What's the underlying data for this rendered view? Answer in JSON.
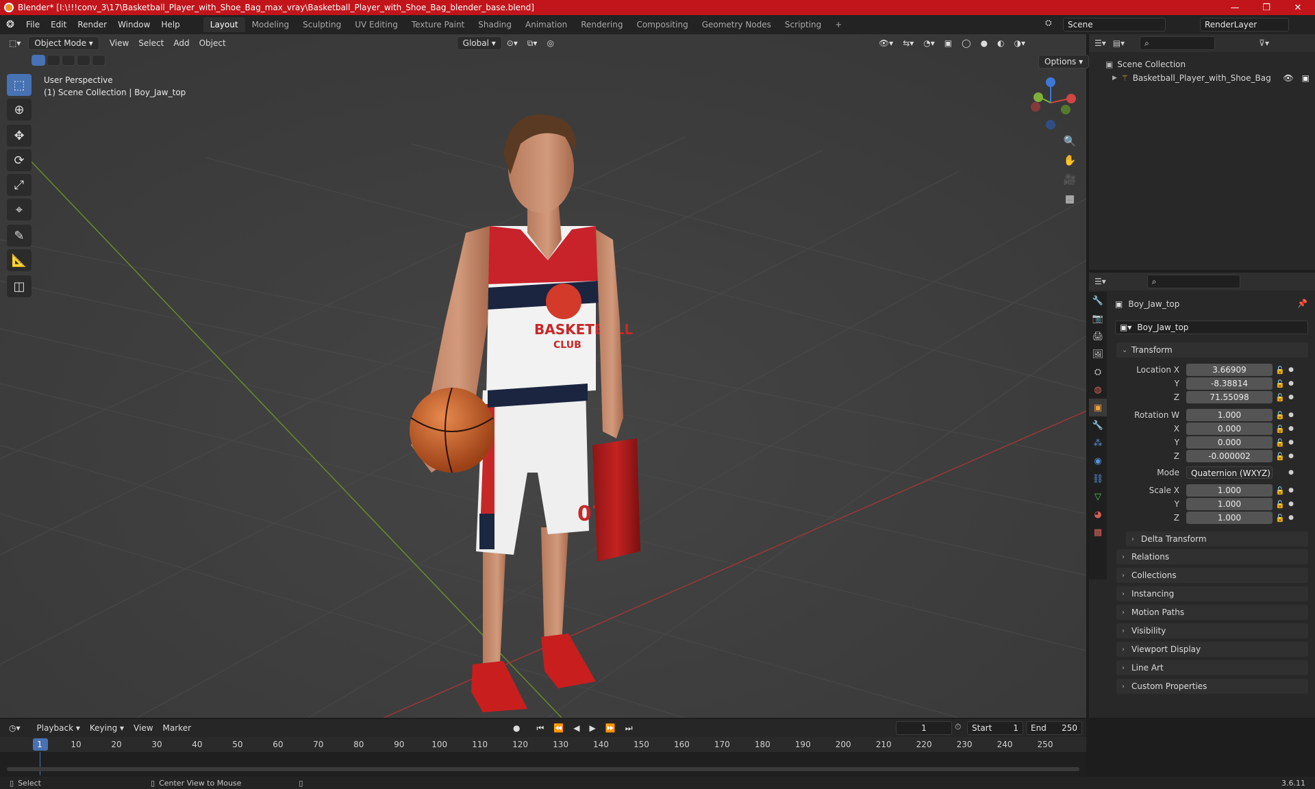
{
  "window": {
    "title": "Blender* [I:\\!!!conv_3\\17\\Basketball_Player_with_Shoe_Bag_max_vray\\Basketball_Player_with_Shoe_Bag_blender_base.blend]",
    "minimize": "—",
    "maximize": "❐",
    "close": "✕"
  },
  "menu": {
    "items": [
      "File",
      "Edit",
      "Render",
      "Window",
      "Help"
    ],
    "workspaces": [
      "Layout",
      "Modeling",
      "Sculpting",
      "UV Editing",
      "Texture Paint",
      "Shading",
      "Animation",
      "Rendering",
      "Compositing",
      "Geometry Nodes",
      "Scripting"
    ],
    "add_workspace": "+",
    "scene_name": "Scene",
    "render_layer": "RenderLayer"
  },
  "viewport": {
    "mode": "Object Mode",
    "menus": [
      "View",
      "Select",
      "Add",
      "Object"
    ],
    "orientation": "Global",
    "options": "Options",
    "perspective": "User Perspective",
    "collection_path": "(1) Scene Collection | Boy_Jaw_top"
  },
  "outliner": {
    "root": "Scene Collection",
    "item": "Basketball_Player_with_Shoe_Bag"
  },
  "properties": {
    "object_name": "Boy_Jaw_top",
    "data_name": "Boy_Jaw_top",
    "transform_label": "Transform",
    "location": {
      "label_x": "Location X",
      "label_y": "Y",
      "label_z": "Z",
      "x": "3.66909",
      "y": "-8.38814",
      "z": "71.55098"
    },
    "rotation": {
      "label_w": "Rotation W",
      "label_x": "X",
      "label_y": "Y",
      "label_z": "Z",
      "w": "1.000",
      "x": "0.000",
      "y": "0.000",
      "z": "-0.000002"
    },
    "mode_label": "Mode",
    "mode_value": "Quaternion (WXYZ)",
    "scale": {
      "label_x": "Scale X",
      "label_y": "Y",
      "label_z": "Z",
      "x": "1.000",
      "y": "1.000",
      "z": "1.000"
    },
    "delta_transform": "Delta Transform",
    "panels": [
      "Relations",
      "Collections",
      "Instancing",
      "Motion Paths",
      "Visibility",
      "Viewport Display",
      "Line Art",
      "Custom Properties"
    ]
  },
  "timeline": {
    "menus": [
      "Playback",
      "Keying",
      "View",
      "Marker"
    ],
    "current_frame": "1",
    "start_label": "Start",
    "start": "1",
    "end_label": "End",
    "end": "250",
    "ticks": [
      "1",
      "10",
      "20",
      "30",
      "40",
      "50",
      "60",
      "70",
      "80",
      "90",
      "100",
      "110",
      "120",
      "130",
      "140",
      "150",
      "160",
      "170",
      "180",
      "190",
      "200",
      "210",
      "220",
      "230",
      "240",
      "250"
    ]
  },
  "status": {
    "select": "Select",
    "center": "Center View to Mouse",
    "version": "3.6.11"
  },
  "model_text": {
    "jersey_line1": "BASKETBALL",
    "jersey_line2": "CLUB",
    "shorts_number": "07"
  }
}
